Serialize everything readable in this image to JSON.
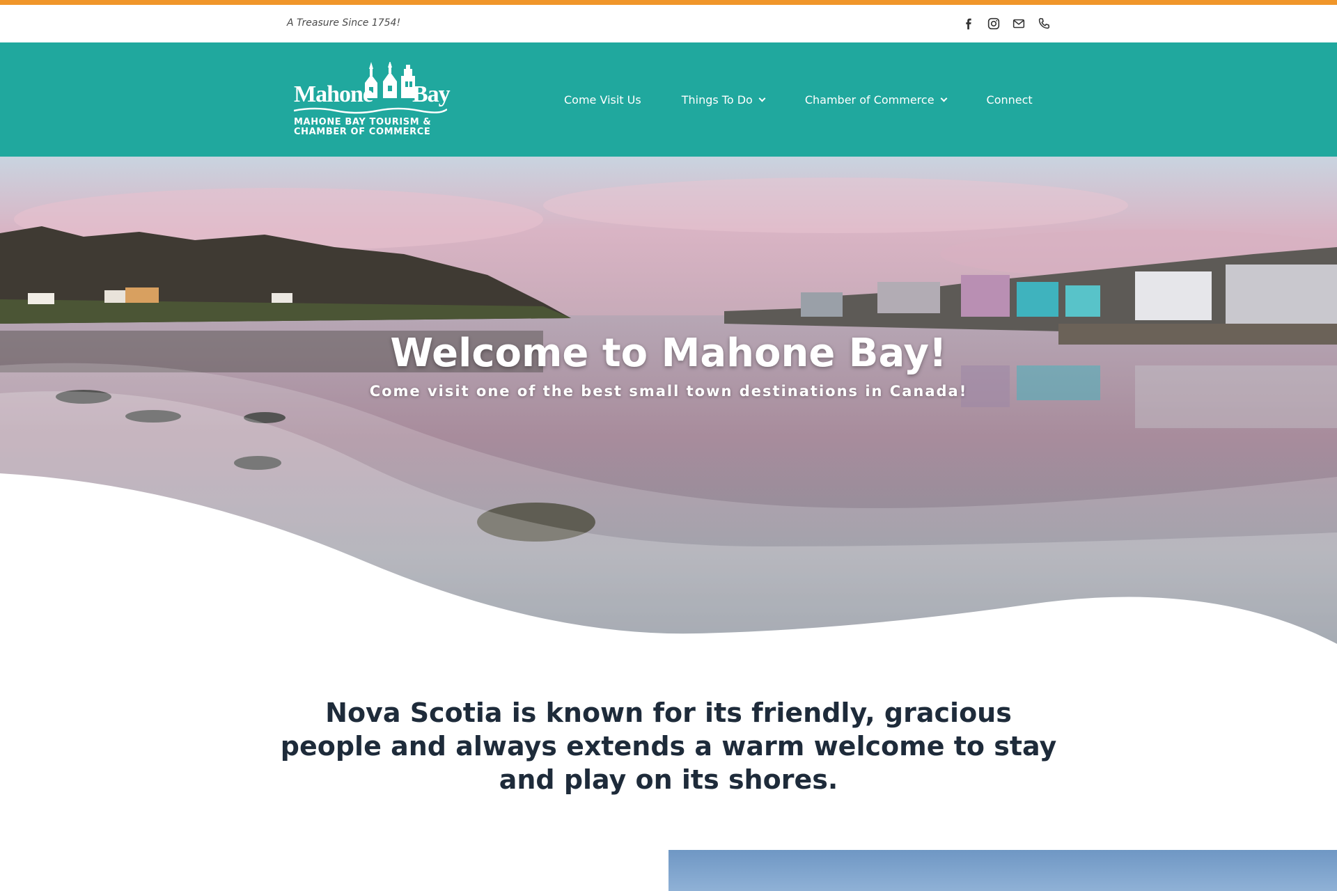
{
  "topbar": {
    "tagline": "A Treasure Since 1754!",
    "social": [
      {
        "icon": "facebook-icon"
      },
      {
        "icon": "instagram-icon"
      },
      {
        "icon": "mail-icon"
      },
      {
        "icon": "phone-icon"
      }
    ]
  },
  "header": {
    "logo": {
      "word_left": "Mahone",
      "word_right": "Bay",
      "subtitle_line1": "MAHONE BAY TOURISM &",
      "subtitle_line2": "CHAMBER OF COMMERCE"
    },
    "nav": [
      {
        "label": "Come Visit Us",
        "has_dropdown": false
      },
      {
        "label": "Things To Do",
        "has_dropdown": true
      },
      {
        "label": "Chamber of Commerce",
        "has_dropdown": true
      },
      {
        "label": "Connect",
        "has_dropdown": false
      }
    ]
  },
  "hero": {
    "title": "Welcome to Mahone Bay!",
    "subtitle": "Come visit one of the best small town destinations in Canada!"
  },
  "intro": {
    "text": "Nova Scotia is known for its friendly, gracious people and always extends a warm welcome to stay and play on its shores."
  },
  "colors": {
    "accent": "#f0962a",
    "header_bg": "#20a89e",
    "text_dark": "#1e2b3a"
  }
}
